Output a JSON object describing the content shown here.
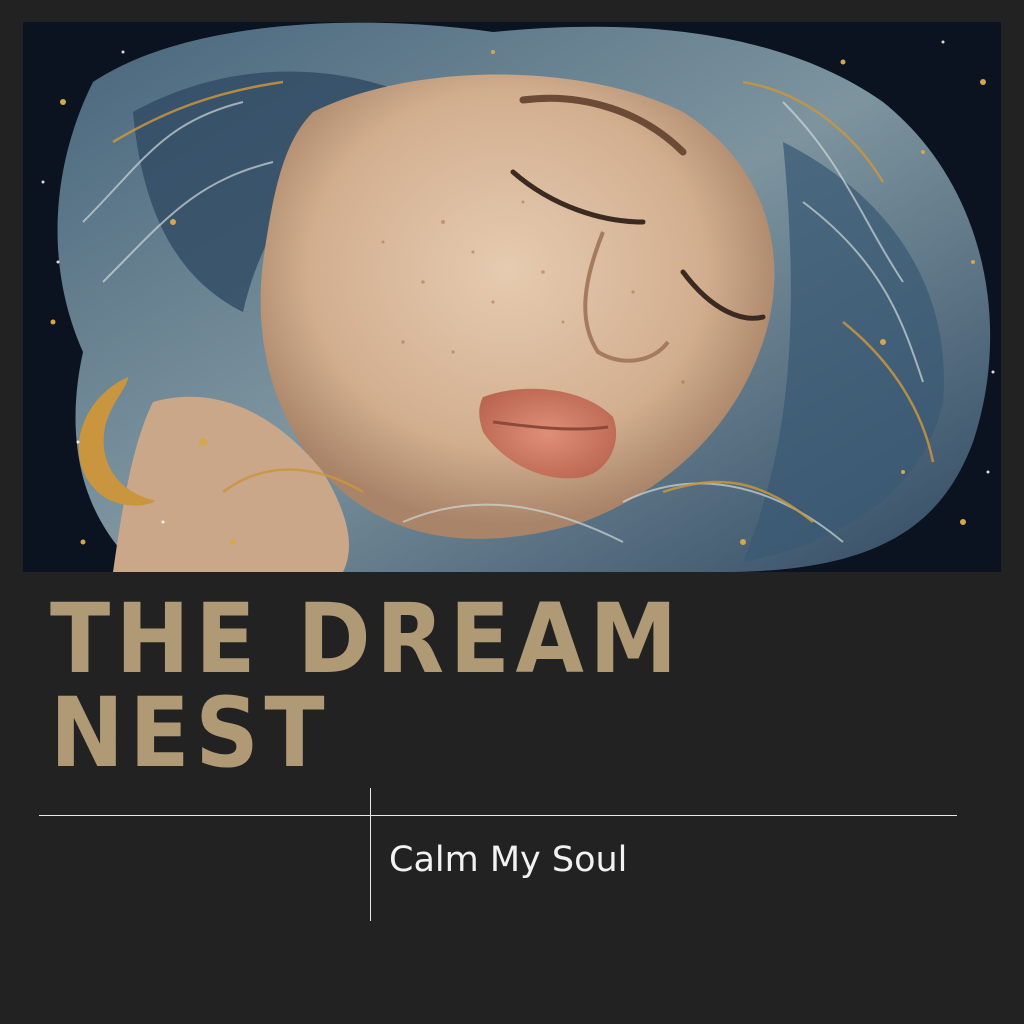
{
  "artwork": {
    "description_icon": "sleeping-woman-illustration-icon",
    "palette": {
      "background": "#0b1220",
      "hair_blue": "#5f7f95",
      "hair_light": "#c7d3d4",
      "gold": "#c9953e",
      "skin": "#d9b79a",
      "lips": "#d17f68"
    }
  },
  "title": {
    "line1": "THE DREAM",
    "line2": "NEST",
    "color": "#b09a76"
  },
  "subtitle": {
    "text": "Calm My Soul",
    "color": "#f2f2f2"
  },
  "page": {
    "background": "#222222",
    "rule_color": "#e8e8e8"
  }
}
